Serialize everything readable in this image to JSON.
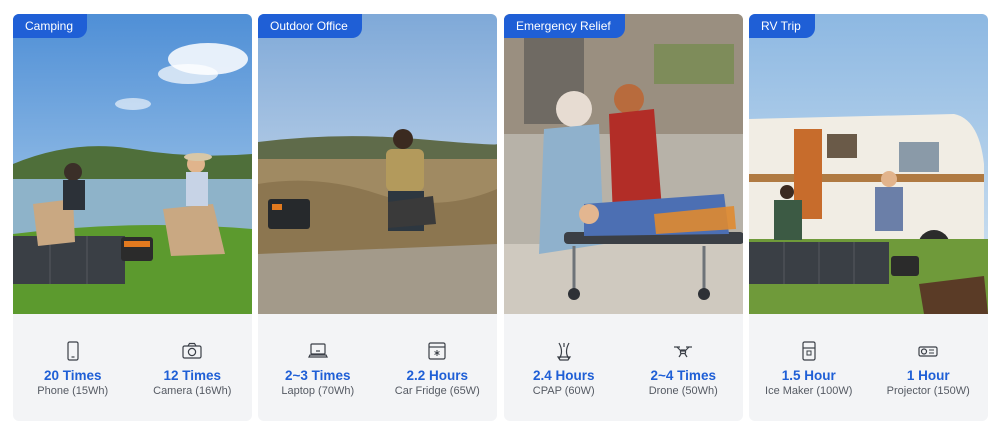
{
  "colors": {
    "accent": "#1f5fd6",
    "card_bg": "#f3f4f6",
    "label": "#555a63"
  },
  "cards": [
    {
      "tag": "Camping",
      "stats": [
        {
          "icon": "phone-icon",
          "value": "20 Times",
          "label": "Phone (15Wh)"
        },
        {
          "icon": "camera-icon",
          "value": "12 Times",
          "label": "Camera (16Wh)"
        }
      ]
    },
    {
      "tag": "Outdoor Office",
      "stats": [
        {
          "icon": "laptop-icon",
          "value": "2~3 Times",
          "label": "Laptop (70Wh)"
        },
        {
          "icon": "car-fridge-icon",
          "value": "2.2 Hours",
          "label": "Car Fridge (65W)"
        }
      ]
    },
    {
      "tag": "Emergency Relief",
      "stats": [
        {
          "icon": "cpap-icon",
          "value": "2.4 Hours",
          "label": "CPAP (60W)"
        },
        {
          "icon": "drone-icon",
          "value": "2~4 Times",
          "label": "Drone (50Wh)"
        }
      ]
    },
    {
      "tag": "RV Trip",
      "stats": [
        {
          "icon": "ice-maker-icon",
          "value": "1.5 Hour",
          "label": "Ice Maker (100W)"
        },
        {
          "icon": "projector-icon",
          "value": "1 Hour",
          "label": "Projector (150W)"
        }
      ]
    }
  ]
}
